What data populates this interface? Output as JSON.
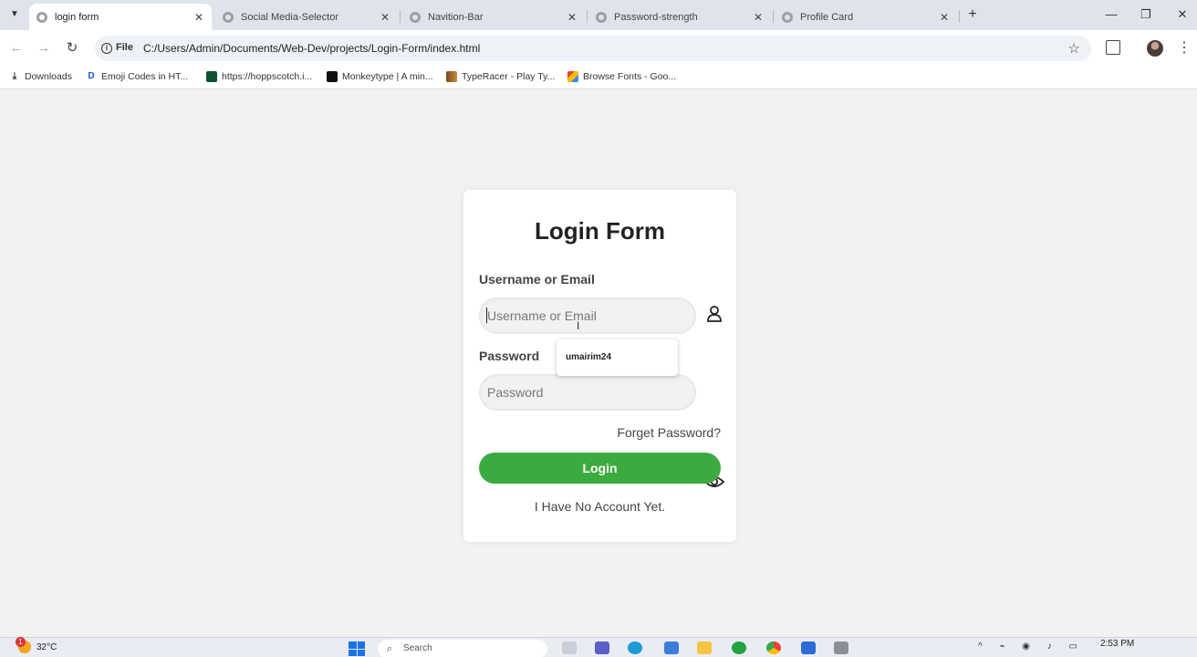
{
  "browser": {
    "tabs": [
      {
        "title": "login form",
        "active": true
      },
      {
        "title": "Social Media-Selector",
        "active": false
      },
      {
        "title": "Navition-Bar",
        "active": false
      },
      {
        "title": "Password-strength",
        "active": false
      },
      {
        "title": "Profile Card",
        "active": false
      }
    ],
    "address": {
      "scheme_chip": "File",
      "url": "C:/Users/Admin/Documents/Web-Dev/projects/Login-Form/index.html"
    },
    "bookmarks": [
      {
        "label": "Downloads",
        "icon": "download-icon"
      },
      {
        "label": "Emoji Codes in HT...",
        "icon": "d-logo-icon"
      },
      {
        "label": "https://hoppscotch.i...",
        "icon": "hoppscotch-icon"
      },
      {
        "label": "Monkeytype | A min...",
        "icon": "monkeytype-icon"
      },
      {
        "label": "TypeRacer - Play Ty...",
        "icon": "typeracer-icon"
      },
      {
        "label": "Browse Fonts - Goo...",
        "icon": "google-fonts-icon"
      }
    ]
  },
  "form": {
    "title": "Login Form",
    "username_label": "Username or Email",
    "username_placeholder": "Username or Email",
    "password_label": "Password",
    "password_placeholder": "Password",
    "autofill_suggestion": "umairim24",
    "forget_link": "Forget Password?",
    "login_button": "Login",
    "no_account_link": "I Have No Account Yet."
  },
  "taskbar": {
    "weather": "32°C",
    "notification_count": "1",
    "search_placeholder": "Search",
    "time": "2:53 PM"
  },
  "colors": {
    "login_button": "#3cab3f",
    "page_background": "#f2f2f2",
    "tabbar": "#dfe3eb"
  }
}
